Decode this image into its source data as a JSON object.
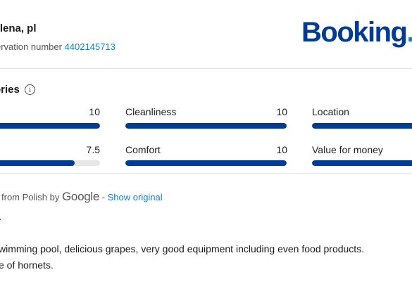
{
  "reviewer": {
    "name": "rlena, pl",
    "reservation_label": "ervation number",
    "reservation_number": "4402145713"
  },
  "brand": {
    "logo_main": "Booking",
    "logo_tail": ".c"
  },
  "categories": {
    "title": "ories",
    "info_icon": "info-icon",
    "items": [
      {
        "label": "",
        "score": "10",
        "fraction": 1.0
      },
      {
        "label": "Cleanliness",
        "score": "10",
        "fraction": 1.0
      },
      {
        "label": "Location",
        "score": "",
        "fraction": 1.0
      },
      {
        "label": "",
        "score": "7.5",
        "fraction": 0.75
      },
      {
        "label": "Comfort",
        "score": "10",
        "fraction": 1.0
      },
      {
        "label": "Value for money",
        "score": "",
        "fraction": 1.0
      }
    ]
  },
  "translation": {
    "prefix": "from Polish by",
    "provider": "Google",
    "separator": "-",
    "show_original": "Show original"
  },
  "review": {
    "title": ".",
    "lines": [
      "wimming pool, delicious grapes, very good equipment including even food products.",
      "e of hornets."
    ]
  },
  "colors": {
    "bar_fill": "#003b95",
    "bar_track": "#e7e7e7",
    "link": "#1a7ac6"
  }
}
